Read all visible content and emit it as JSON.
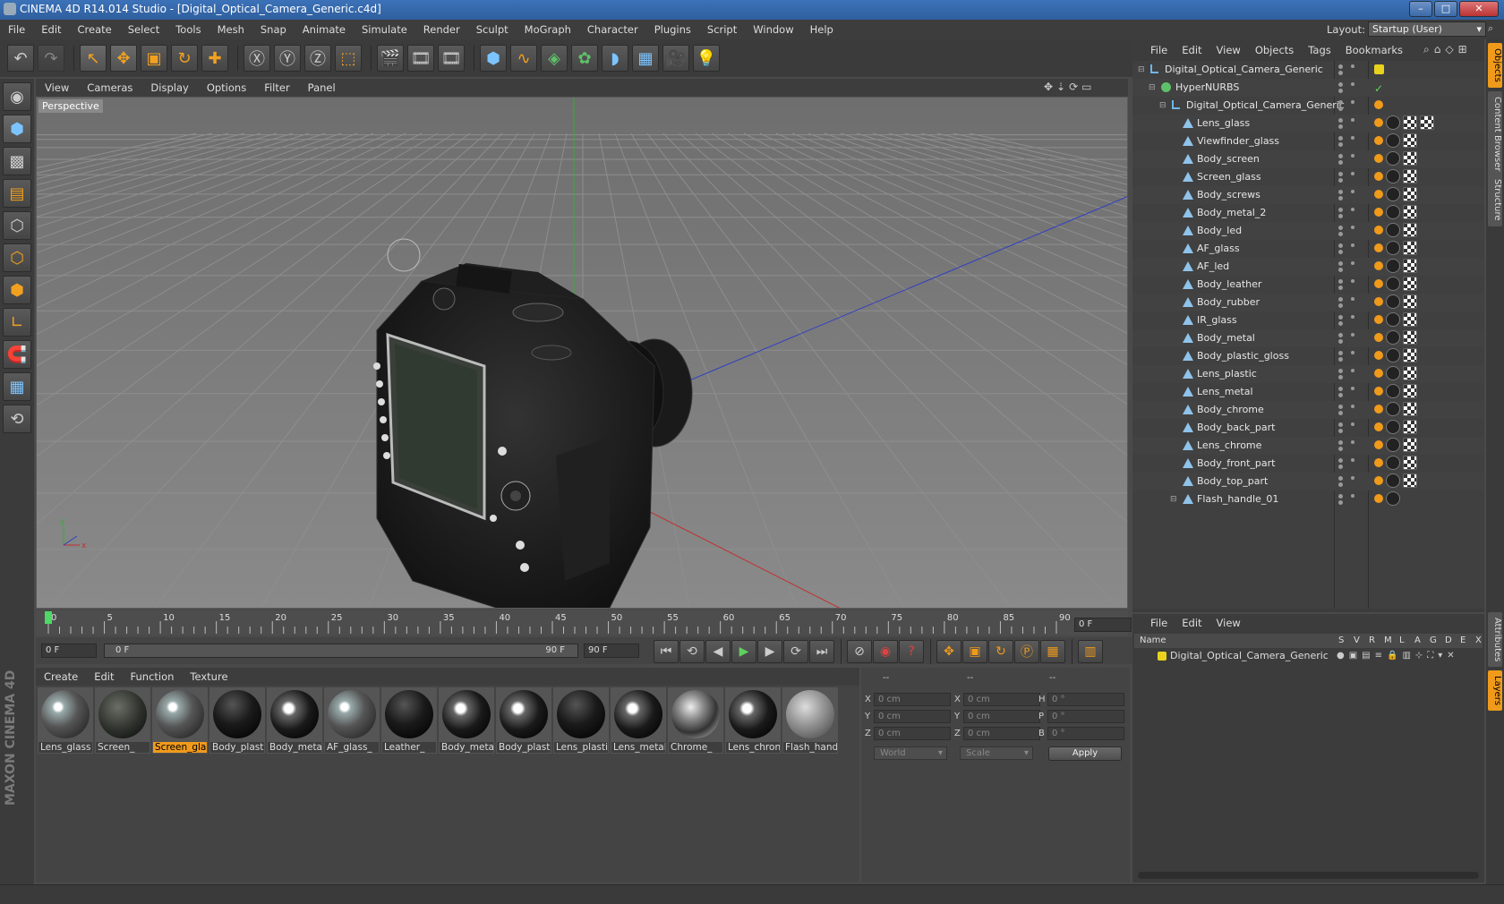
{
  "window": {
    "title": "CINEMA 4D R14.014 Studio - [Digital_Optical_Camera_Generic.c4d]"
  },
  "menubar": [
    "File",
    "Edit",
    "Create",
    "Select",
    "Tools",
    "Mesh",
    "Snap",
    "Animate",
    "Simulate",
    "Render",
    "Sculpt",
    "MoGraph",
    "Character",
    "Plugins",
    "Script",
    "Window",
    "Help"
  ],
  "layout": {
    "label": "Layout:",
    "value": "Startup (User)"
  },
  "viewport": {
    "menu": [
      "View",
      "Cameras",
      "Display",
      "Options",
      "Filter",
      "Panel"
    ],
    "label": "Perspective"
  },
  "timeline": {
    "ticks": [
      "0",
      "5",
      "10",
      "15",
      "20",
      "25",
      "30",
      "35",
      "40",
      "45",
      "50",
      "55",
      "60",
      "65",
      "70",
      "75",
      "80",
      "85",
      "90"
    ],
    "current_frame": "0 F"
  },
  "transport": {
    "start": "0 F",
    "range_start": "0 F",
    "range_end": "90 F",
    "end": "90 F"
  },
  "material_manager": {
    "menu": [
      "Create",
      "Edit",
      "Function",
      "Texture"
    ],
    "materials": [
      {
        "name": "Lens_glass",
        "look": "glass"
      },
      {
        "name": "Screen_",
        "look": "dark"
      },
      {
        "name": "Screen_gla",
        "look": "glass",
        "selected": true
      },
      {
        "name": "Body_plast",
        "look": "black"
      },
      {
        "name": "Body_meta",
        "look": "shiny"
      },
      {
        "name": "AF_glass_",
        "look": "glass"
      },
      {
        "name": "Leather_",
        "look": "black"
      },
      {
        "name": "Body_meta",
        "look": "shiny"
      },
      {
        "name": "Body_plast",
        "look": "shiny"
      },
      {
        "name": "Lens_plasti",
        "look": "black"
      },
      {
        "name": "Lens_metal",
        "look": "shiny"
      },
      {
        "name": "Chrome_",
        "look": "chrome"
      },
      {
        "name": "Lens_chron",
        "look": "shiny"
      },
      {
        "name": "Flash_hand",
        "look": "grey"
      }
    ]
  },
  "coordinates": {
    "headers": [
      "--",
      "--",
      "--"
    ],
    "rows": [
      {
        "a": "X",
        "av": "0 cm",
        "b": "X",
        "bv": "0 cm",
        "c": "H",
        "cv": "0 °"
      },
      {
        "a": "Y",
        "av": "0 cm",
        "b": "Y",
        "bv": "0 cm",
        "c": "P",
        "cv": "0 °"
      },
      {
        "a": "Z",
        "av": "0 cm",
        "b": "Z",
        "bv": "0 cm",
        "c": "B",
        "cv": "0 °"
      }
    ],
    "space": "World",
    "mode": "Scale",
    "apply": "Apply"
  },
  "objects_panel": {
    "menu": [
      "File",
      "Edit",
      "View",
      "Objects",
      "Tags",
      "Bookmarks"
    ],
    "items": [
      {
        "name": "Digital_Optical_Camera_Generic",
        "level": 0,
        "type": "null"
      },
      {
        "name": "HyperNURBS",
        "level": 1,
        "type": "nurbs"
      },
      {
        "name": "Digital_Optical_Camera_Generic",
        "level": 2,
        "type": "null"
      },
      {
        "name": "Lens_glass",
        "level": 3,
        "type": "mesh"
      },
      {
        "name": "Viewfinder_glass",
        "level": 3,
        "type": "mesh"
      },
      {
        "name": "Body_screen",
        "level": 3,
        "type": "mesh"
      },
      {
        "name": "Screen_glass",
        "level": 3,
        "type": "mesh"
      },
      {
        "name": "Body_screws",
        "level": 3,
        "type": "mesh"
      },
      {
        "name": "Body_metal_2",
        "level": 3,
        "type": "mesh"
      },
      {
        "name": "Body_led",
        "level": 3,
        "type": "mesh"
      },
      {
        "name": "AF_glass",
        "level": 3,
        "type": "mesh"
      },
      {
        "name": "AF_led",
        "level": 3,
        "type": "mesh"
      },
      {
        "name": "Body_leather",
        "level": 3,
        "type": "mesh"
      },
      {
        "name": "Body_rubber",
        "level": 3,
        "type": "mesh"
      },
      {
        "name": "IR_glass",
        "level": 3,
        "type": "mesh"
      },
      {
        "name": "Body_metal",
        "level": 3,
        "type": "mesh"
      },
      {
        "name": "Body_plastic_gloss",
        "level": 3,
        "type": "mesh"
      },
      {
        "name": "Lens_plastic",
        "level": 3,
        "type": "mesh"
      },
      {
        "name": "Lens_metal",
        "level": 3,
        "type": "mesh"
      },
      {
        "name": "Body_chrome",
        "level": 3,
        "type": "mesh"
      },
      {
        "name": "Body_back_part",
        "level": 3,
        "type": "mesh"
      },
      {
        "name": "Lens_chrome",
        "level": 3,
        "type": "mesh"
      },
      {
        "name": "Body_front_part",
        "level": 3,
        "type": "mesh"
      },
      {
        "name": "Body_top_part",
        "level": 3,
        "type": "mesh"
      },
      {
        "name": "Flash_handle_01",
        "level": 3,
        "type": "mesh"
      }
    ]
  },
  "layers_panel": {
    "menu": [
      "File",
      "Edit",
      "View"
    ],
    "columns": [
      "Name",
      "S",
      "V",
      "R",
      "M",
      "L",
      "A",
      "G",
      "D",
      "E",
      "X"
    ],
    "row": "Digital_Optical_Camera_Generic"
  },
  "side_tabs": [
    "Objects",
    "Content Browser",
    "Structure",
    "Attributes",
    "Layers"
  ],
  "brand": "MAXON CINEMA 4D",
  "colors": {
    "accent": "#f09a1c",
    "titlebar": "#3c72b8",
    "x_axis": "#c03030",
    "y_axis": "#30b030",
    "z_axis": "#3040c0"
  }
}
